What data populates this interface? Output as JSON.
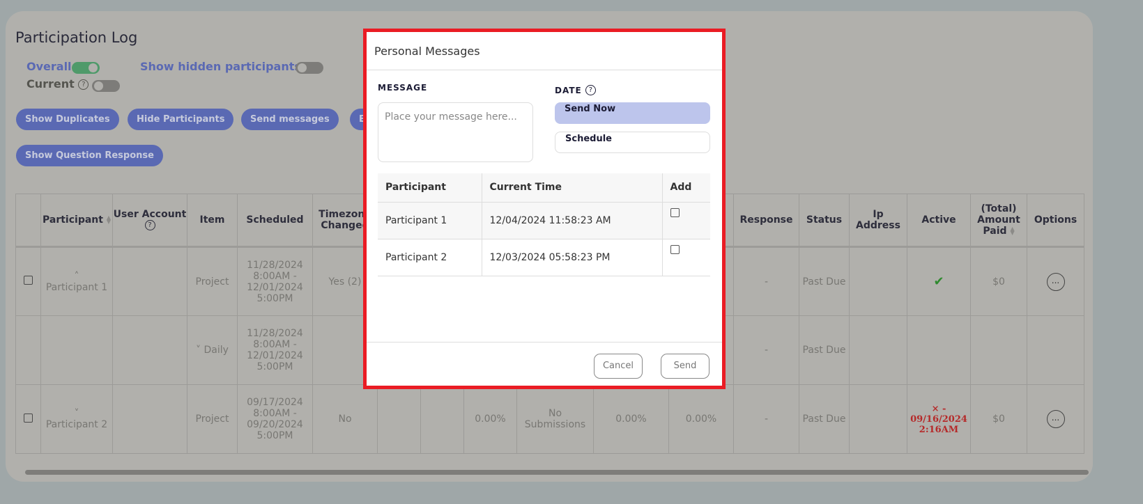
{
  "page": {
    "title": "Participation Log",
    "toggles": [
      {
        "label": "Overall",
        "on": true
      },
      {
        "label": "Show hidden participants",
        "on": false
      },
      {
        "label": "Current",
        "on": false
      }
    ],
    "buttons": [
      "Show Duplicates",
      "Hide Participants",
      "Send messages",
      "E",
      "Show Question Response"
    ]
  },
  "table": {
    "headers": [
      "",
      "Participant",
      "User Account",
      "Item",
      "Scheduled",
      "Timezone Changed",
      "",
      "",
      "",
      "",
      "",
      "",
      "",
      "Response",
      "Status",
      "Ip Address",
      "Active",
      "(Total) Amount Paid",
      "Options"
    ],
    "rows": [
      {
        "participant": "Participant 1",
        "item": "Project",
        "scheduled": "11/28/2024 8:00AM - 12/01/2024 5:00PM",
        "timezone": "Yes (2)",
        "response": "-",
        "status": "Past Due",
        "active": "check",
        "paid": "$0",
        "options": "..."
      },
      {
        "participant": "",
        "item": "Daily",
        "scheduled": "11/28/2024 8:00AM - 12/01/2024 5:00PM",
        "timezone": "",
        "response": "-",
        "status": "Past Due",
        "active": "",
        "paid": "",
        "options": ""
      },
      {
        "participant": "Participant 2",
        "item": "Project",
        "scheduled": "09/17/2024 8:00AM - 09/20/2024 5:00PM",
        "timezone": "No",
        "c8": "0.00%",
        "c9": "No Submissions",
        "c10": "0.00%",
        "c11": "0.00%",
        "response": "-",
        "status": "Past Due",
        "active": "× - 09/16/2024 2:16AM",
        "paid": "$0",
        "options": "..."
      }
    ]
  },
  "modal": {
    "title": "Personal Messages",
    "message_label": "MESSAGE",
    "message_placeholder": "Place your message here...",
    "date_label": "DATE",
    "send_now": "Send Now",
    "schedule": "Schedule",
    "headers": [
      "Participant",
      "Current Time",
      "Add"
    ],
    "rows": [
      {
        "participant": "Participant 1",
        "time": "12/04/2024 11:58:23 AM"
      },
      {
        "participant": "Participant 2",
        "time": "12/03/2024 05:58:23 PM"
      }
    ],
    "cancel": "Cancel",
    "send": "Send"
  },
  "colors": {
    "accent": "#5a69b3",
    "modal_border": "#ea1c24",
    "toggle_on": "#4f9a6a",
    "active_check": "#2f8a2f",
    "inactive": "#b52a2a"
  }
}
